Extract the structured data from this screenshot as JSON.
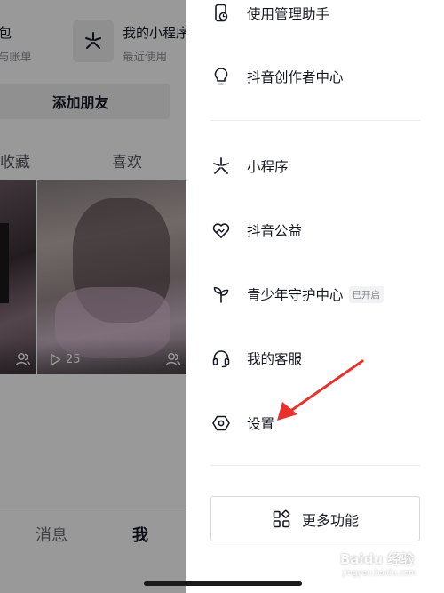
{
  "background": {
    "wallet_title": "包",
    "wallet_sub": "与账单",
    "mini_title": "我的小程序",
    "mini_sub": "最近使用",
    "add_friend": "添加朋友",
    "tab_favorites": "收藏",
    "tab_likes": "喜欢",
    "play_count": "25",
    "nav_messages": "消息",
    "nav_me": "我"
  },
  "drawer": {
    "items": [
      {
        "label": "使用管理助手",
        "icon": "phone-clock-icon"
      },
      {
        "label": "抖音创作者中心",
        "icon": "lightbulb-icon"
      },
      {
        "label": "小程序",
        "icon": "mini-program-icon"
      },
      {
        "label": "抖音公益",
        "icon": "charity-heart-icon"
      },
      {
        "label": "青少年守护中心",
        "icon": "sprout-icon",
        "badge": "已开启"
      },
      {
        "label": "我的客服",
        "icon": "headset-icon"
      },
      {
        "label": "设置",
        "icon": "hexagon-settings-icon"
      }
    ],
    "more_button": "更多功能"
  },
  "watermark": {
    "brand": "Baidu 经验",
    "sub": "jingyan.baidu.com"
  },
  "colors": {
    "accent_arrow": "#e8312c",
    "dim_overlay": "rgba(0,0,0,0.40)"
  }
}
